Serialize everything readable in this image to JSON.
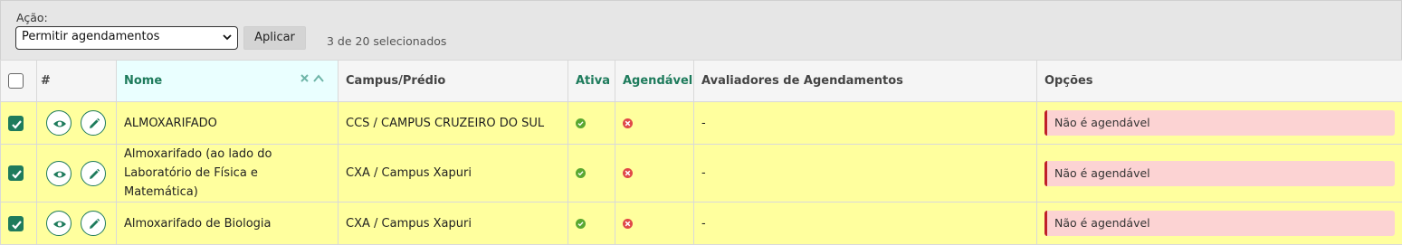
{
  "actions": {
    "label": "Ação:",
    "select_value": "Permitir agendamentos",
    "apply_label": "Aplicar",
    "selection_count": "3 de 20 selecionados"
  },
  "table": {
    "headers": {
      "hash": "#",
      "nome": "Nome",
      "campus": "Campus/Prédio",
      "ativa": "Ativa",
      "agendavel": "Agendável",
      "avaliadores": "Avaliadores de Agendamentos",
      "opcoes": "Opções"
    },
    "sort_icons": "✕ ^",
    "rows": [
      {
        "nome": "ALMOXARIFADO",
        "campus": "CCS / CAMPUS CRUZEIRO DO SUL",
        "avaliadores": "-",
        "opcoes": "Não é agendável"
      },
      {
        "nome": "Almoxarifado (ao lado do Laboratório de Física e Matemática)",
        "campus": "CXA / Campus Xapuri",
        "avaliadores": "-",
        "opcoes": "Não é agendável"
      },
      {
        "nome": "Almoxarifado de Biologia",
        "campus": "CXA / Campus Xapuri",
        "avaliadores": "-",
        "opcoes": "Não é agendável"
      }
    ]
  },
  "colors": {
    "accent": "#1e7b5c",
    "row_highlight": "#ffff9e",
    "alert_bg": "#fcd3d3",
    "alert_border": "#c0202a",
    "ok": "#5aa832",
    "error": "#e04848"
  },
  "icons": [
    "chevron-down-icon",
    "check-icon",
    "eye-icon",
    "pencil-icon",
    "check-circle-icon",
    "x-circle-icon"
  ]
}
